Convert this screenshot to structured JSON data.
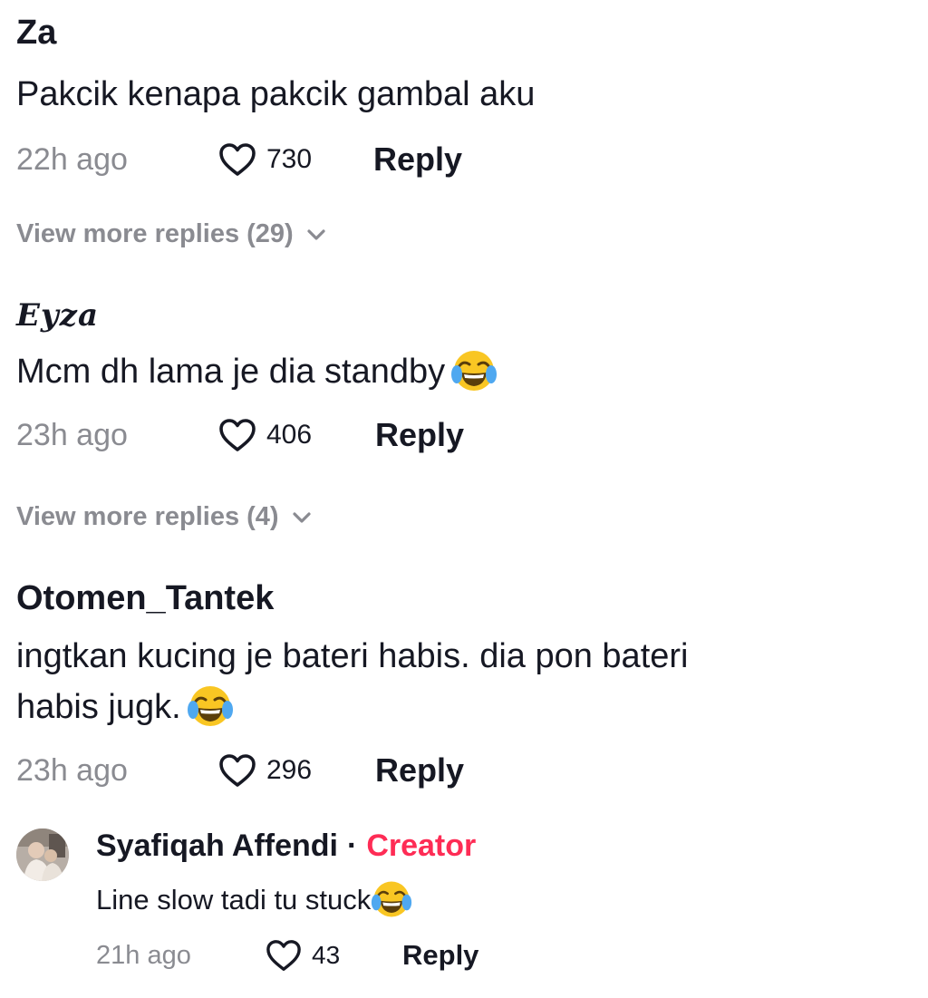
{
  "comments": [
    {
      "username": "Za",
      "text": "Pakcik kenapa pakcik gambal aku",
      "time": "22h ago",
      "likes": "730",
      "reply_label": "Reply",
      "view_more": "View more replies (29)"
    },
    {
      "username": "Eyza",
      "text": "Mcm dh lama je dia standby",
      "emoji": "face-with-tears-of-joy",
      "time": "23h ago",
      "likes": "406",
      "reply_label": "Reply",
      "view_more": "View more replies (4)"
    },
    {
      "username": "Otomen_Tantek",
      "text_line1": "ingtkan kucing je bateri habis. dia pon bateri",
      "text_line2": "habis jugk.",
      "emoji": "face-with-tears-of-joy",
      "time": "23h ago",
      "likes": "296",
      "reply_label": "Reply"
    }
  ],
  "reply": {
    "username": "Syafiqah Affendi",
    "separator": "·",
    "badge": "Creator",
    "text": "Line slow tadi tu stuck",
    "emoji": "face-with-tears-of-joy",
    "time": "21h ago",
    "likes": "43",
    "reply_label": "Reply"
  },
  "colors": {
    "text": "#161823",
    "muted": "#8a8b91",
    "creator": "#fe2c55",
    "background": "#ffffff"
  }
}
